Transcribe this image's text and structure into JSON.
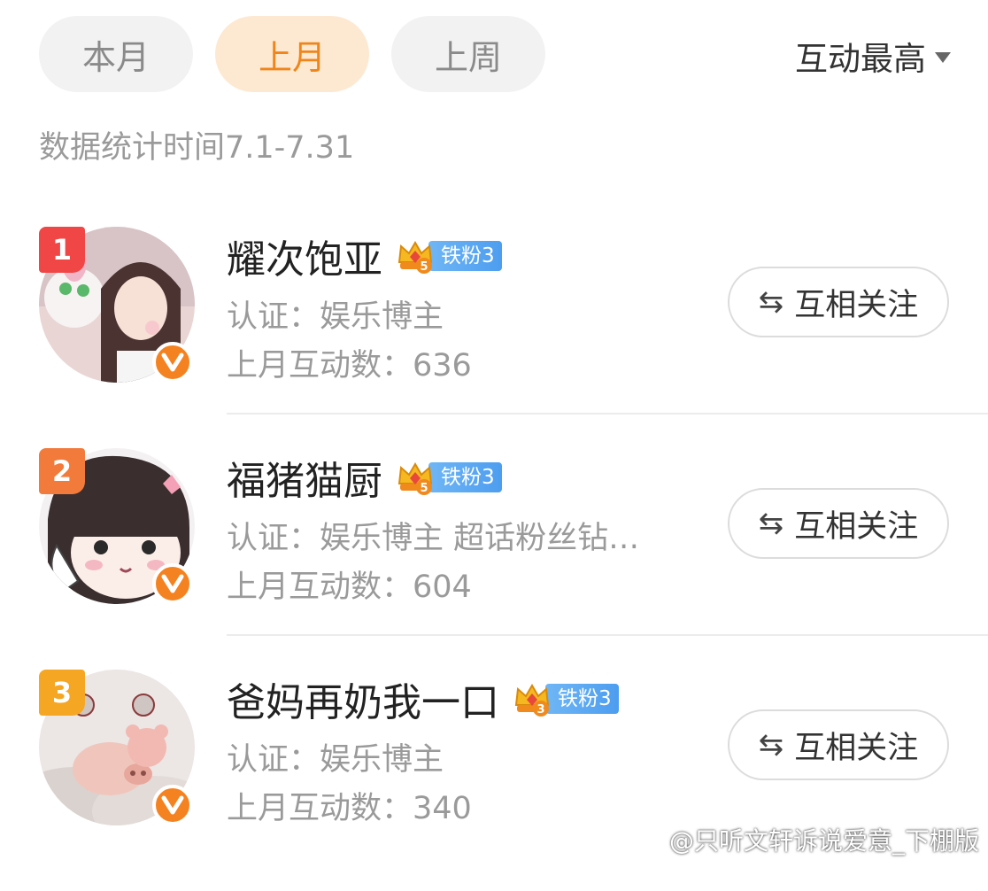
{
  "tabs": [
    {
      "label": "本月",
      "active": false
    },
    {
      "label": "上月",
      "active": true
    },
    {
      "label": "上周",
      "active": false
    }
  ],
  "sort": {
    "label": "互动最高",
    "icon": "caret-down-icon"
  },
  "stat_period": "数据统计时间7.1-7.31",
  "colors": {
    "accent": "#f08519",
    "active_tab_bg": "#fde9d2",
    "rank_1": "#f04646",
    "rank_2": "#f27a3a",
    "rank_3": "#f5a623",
    "verified": "#f58220",
    "fan_badge": "#4d9df0"
  },
  "users": [
    {
      "rank": "1",
      "name": "耀次饱亚",
      "fan_level": "5",
      "fan_badge": "铁粉3",
      "certification": "认证：娱乐博主",
      "interaction_count": "上月互动数：636",
      "follow_label": "互相关注",
      "follow_icon": "swap-arrows-icon"
    },
    {
      "rank": "2",
      "name": "福猪猫厨",
      "fan_level": "5",
      "fan_badge": "铁粉3",
      "certification": "认证：娱乐博主 超话粉丝钻…",
      "interaction_count": "上月互动数：604",
      "follow_label": "互相关注",
      "follow_icon": "swap-arrows-icon"
    },
    {
      "rank": "3",
      "name": "爸妈再奶我一口",
      "fan_level": "3",
      "fan_badge": "铁粉3",
      "certification": "认证：娱乐博主",
      "interaction_count": "上月互动数：340",
      "follow_label": "互相关注",
      "follow_icon": "swap-arrows-icon"
    }
  ],
  "watermark": "@只听文轩诉说爱意_下棚版"
}
